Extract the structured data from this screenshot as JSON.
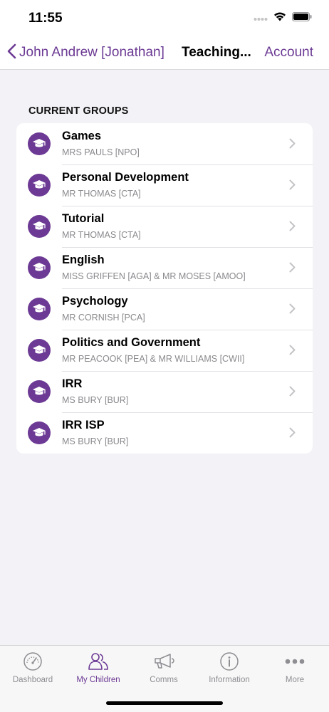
{
  "status": {
    "time": "11:55"
  },
  "nav": {
    "back_label": "John Andrew [Jonathan]",
    "title": "Teaching...",
    "action_label": "Account"
  },
  "section": {
    "header": "CURRENT GROUPS"
  },
  "groups": [
    {
      "title": "Games",
      "teachers": "MRS PAULS [NPO]"
    },
    {
      "title": "Personal Development",
      "teachers": "MR THOMAS [CTA]"
    },
    {
      "title": "Tutorial",
      "teachers": "MR THOMAS [CTA]"
    },
    {
      "title": "English",
      "teachers": "MISS GRIFFEN [AGA] & MR MOSES [AMOO]"
    },
    {
      "title": "Psychology",
      "teachers": "MR CORNISH [PCA]"
    },
    {
      "title": "Politics and Government",
      "teachers": "MR PEACOOK [PEA] & MR WILLIAMS [CWII]"
    },
    {
      "title": "IRR",
      "teachers": "MS BURY [BUR]"
    },
    {
      "title": "IRR ISP",
      "teachers": "MS BURY [BUR]"
    }
  ],
  "tabs": [
    {
      "label": "Dashboard",
      "icon": "speedometer-icon",
      "active": false
    },
    {
      "label": "My Children",
      "icon": "people-icon",
      "active": true
    },
    {
      "label": "Comms",
      "icon": "megaphone-icon",
      "active": false
    },
    {
      "label": "Information",
      "icon": "info-icon",
      "active": false
    },
    {
      "label": "More",
      "icon": "more-icon",
      "active": false
    }
  ],
  "colors": {
    "accent": "#6c3a94",
    "inactive": "#8e8e93"
  }
}
